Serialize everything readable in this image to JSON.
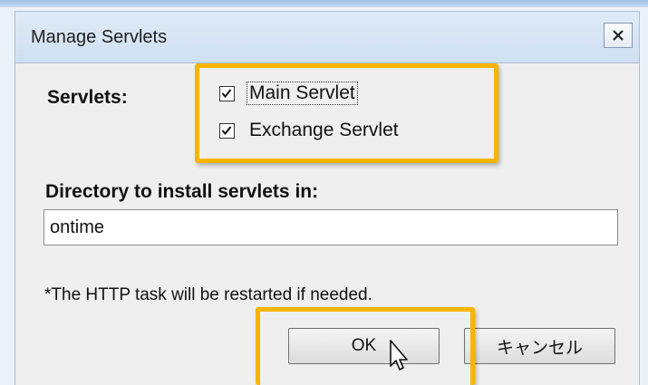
{
  "dialog": {
    "title": "Manage Servlets",
    "close_label": "×"
  },
  "servlets": {
    "label": "Servlets:",
    "items": [
      {
        "label": "Main Servlet",
        "checked": true
      },
      {
        "label": "Exchange Servlet",
        "checked": true
      }
    ]
  },
  "directory": {
    "label": "Directory to install servlets in:",
    "value": "ontime"
  },
  "note": "*The HTTP task will be restarted if needed.",
  "buttons": {
    "ok": "OK",
    "cancel": "キャンセル"
  },
  "colors": {
    "highlight": "#f7b500",
    "titlebar": "#cfe0f2",
    "body": "#efefef"
  }
}
